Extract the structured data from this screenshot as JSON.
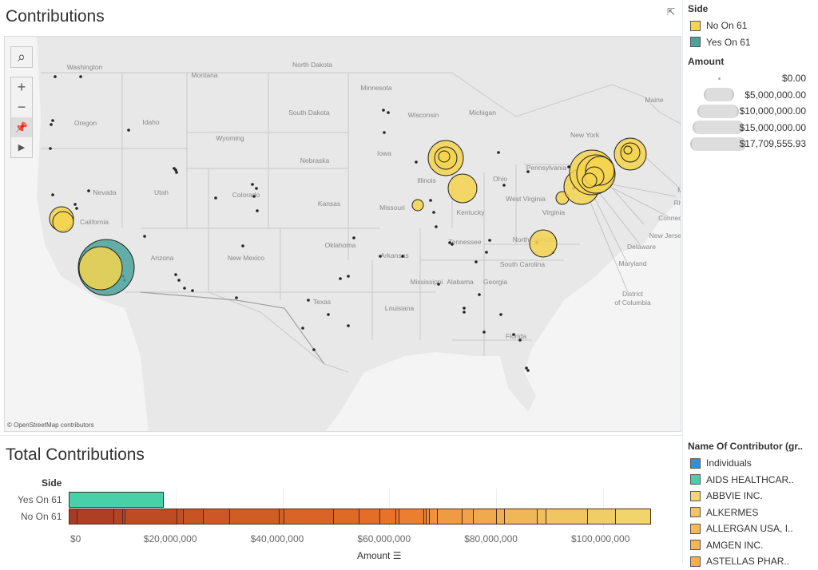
{
  "map_title": "Contributions",
  "bar_title": "Total Contributions",
  "credit": "© OpenStreetMap contributors",
  "map_controls": {
    "search": "search-icon",
    "zoom_in": "+",
    "zoom_out": "−",
    "pin": "pin-icon",
    "play": "play-icon"
  },
  "states": [
    "Washington",
    "Montana",
    "North Dakota",
    "Minnesota",
    "Oregon",
    "Idaho",
    "Wyoming",
    "South Dakota",
    "Wisconsin",
    "Michigan",
    "Iowa",
    "Nebraska",
    "Nevada",
    "Utah",
    "Colorado",
    "Kansas",
    "Illinois",
    "Missouri",
    "Ohio",
    "Kentucky",
    "West Virginia",
    "Virginia",
    "California",
    "Pennsylvania",
    "New York",
    "Tennessee",
    "North Carolina",
    "Oklahoma",
    "Arkansas",
    "Arizona",
    "New Mexico",
    "South Carolina",
    "Mississippi",
    "Alabama",
    "Georgia",
    "Texas",
    "Louisiana",
    "Florida",
    "Maine",
    "Delaware",
    "Maryland",
    "New Jersey",
    "Connect",
    "Rh",
    "District",
    "of Columbia",
    "Ma"
  ],
  "side_legend": {
    "title": "Side",
    "items": [
      {
        "label": "No On 61",
        "color": "#f5d44f"
      },
      {
        "label": "Yes On 61",
        "color": "#4aa39a"
      }
    ]
  },
  "amount_legend": {
    "title": "Amount",
    "items": [
      "$0.00",
      "$5,000,000.00",
      "$10,000,000.00",
      "$15,000,000.00",
      "$17,709,555.93"
    ]
  },
  "contributor_legend": {
    "title": "Name Of Contributor (gr..",
    "items": [
      {
        "label": "Individuals",
        "color": "#2f8fe8"
      },
      {
        "label": "AIDS HEALTHCAR..",
        "color": "#48d0a8"
      },
      {
        "label": "ABBVIE INC.",
        "color": "#f3d770"
      },
      {
        "label": "ALKERMES",
        "color": "#f5c45e"
      },
      {
        "label": "ALLERGAN USA, I..",
        "color": "#f6b95a"
      },
      {
        "label": "AMGEN INC.",
        "color": "#f7b457"
      },
      {
        "label": "ASTELLAS PHAR..",
        "color": "#f7ad54"
      }
    ]
  },
  "chart_data": {
    "type": "bar",
    "stacked": true,
    "orientation": "horizontal",
    "ylabel": "Side",
    "xlabel": "Amount",
    "categories": [
      "Yes On 61",
      "No On 61"
    ],
    "xlim": [
      0,
      109000000
    ],
    "xticks": [
      "$0",
      "$20,000,000",
      "$40,000,000",
      "$60,000,000",
      "$80,000,000",
      "$100,000,000"
    ],
    "xtick_values": [
      0,
      20000000,
      40000000,
      60000000,
      80000000,
      100000000
    ],
    "yes_total": 17800000,
    "yes_color": "#48d0a8",
    "no_segment_bounds_millions": [
      0,
      1.5,
      8.4,
      10,
      10.5,
      20.2,
      21.4,
      25.1,
      30,
      39.3,
      40.2,
      49.5,
      54.3,
      58.1,
      61.1,
      61.7,
      66.4,
      66.8,
      67.4,
      68.9,
      73.5,
      75.6,
      79.9,
      81.5,
      87.6,
      89.2,
      97,
      102.2,
      109
    ],
    "no_color_start": "#a93b23",
    "no_color_end": "#f2d46c"
  }
}
